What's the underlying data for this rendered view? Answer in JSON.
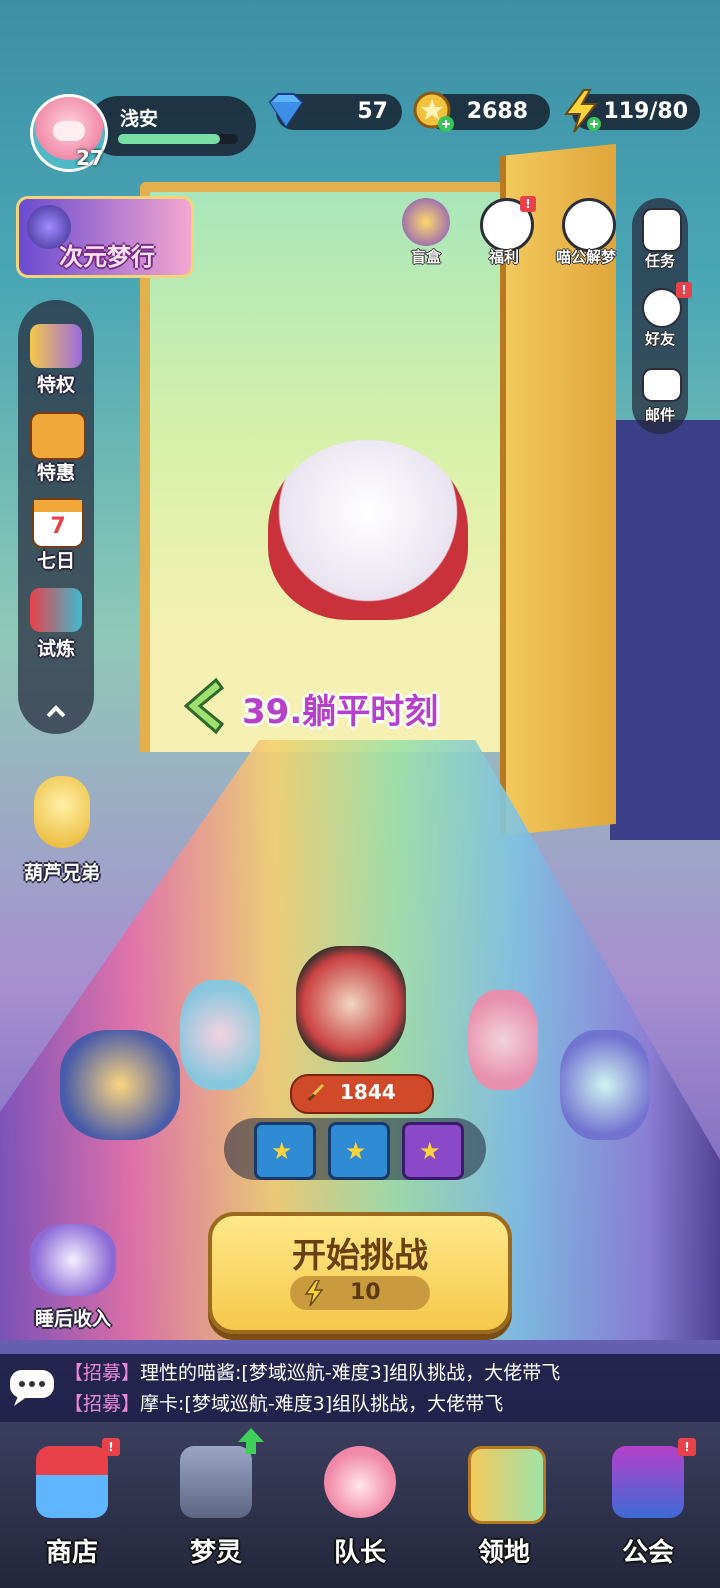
{
  "player": {
    "name": "浅安",
    "level": "27",
    "exp_fraction": 0.85
  },
  "currency": {
    "gems": "57",
    "coins": "2688",
    "energy": "119/80"
  },
  "event_banner": {
    "label": "次元梦行"
  },
  "top_icons": [
    {
      "label": "盲盒",
      "icon": "blind-box-icon",
      "badge": false
    },
    {
      "label": "福利",
      "icon": "gift-icon",
      "badge": true
    },
    {
      "label": "喵公解梦",
      "icon": "cat-dream-icon",
      "badge": false
    }
  ],
  "right_menu": [
    {
      "label": "任务",
      "icon": "task-icon",
      "badge": false
    },
    {
      "label": "好友",
      "icon": "friends-icon",
      "badge": true
    },
    {
      "label": "邮件",
      "icon": "mail-icon",
      "badge": false
    }
  ],
  "left_menu": [
    {
      "label": "特权",
      "icon": "privilege-card-icon"
    },
    {
      "label": "特惠",
      "icon": "sale-box-icon"
    },
    {
      "label": "七日",
      "icon": "calendar-icon",
      "calendar_number": "7"
    },
    {
      "label": "试炼",
      "icon": "trial-cannon-icon"
    }
  ],
  "gourd_event": {
    "label": "葫芦兄弟"
  },
  "stage": {
    "title": "39.躺平时刻"
  },
  "team": {
    "power": "1844",
    "reward_chests": 3
  },
  "challenge_button": {
    "label": "开始挑战",
    "cost": "10"
  },
  "idle_income": {
    "label": "睡后收入"
  },
  "chat": [
    {
      "tag": "【招募】",
      "text": "理性的喵酱:[梦域巡航-难度3]组队挑战，大佬带飞"
    },
    {
      "tag": "【招募】",
      "text": "摩卡:[梦域巡航-难度3]组队挑战，大佬带飞"
    }
  ],
  "bottom_nav": [
    {
      "label": "商店",
      "icon": "shop-icon",
      "badge": "!",
      "badge_type": "red"
    },
    {
      "label": "梦灵",
      "icon": "robot-icon",
      "badge": "up-arrow",
      "badge_type": "green"
    },
    {
      "label": "队长",
      "icon": "captain-avatar-icon",
      "badge": "",
      "badge_type": "none"
    },
    {
      "label": "领地",
      "icon": "territory-door-icon",
      "badge": "",
      "badge_type": "none"
    },
    {
      "label": "公会",
      "icon": "guild-icon",
      "badge": "!",
      "badge_type": "red"
    }
  ],
  "colors": {
    "accent_purple": "#b640c9",
    "gold": "#f5c84a",
    "badge_red": "#e8414a",
    "up_green": "#3fcf5a"
  }
}
